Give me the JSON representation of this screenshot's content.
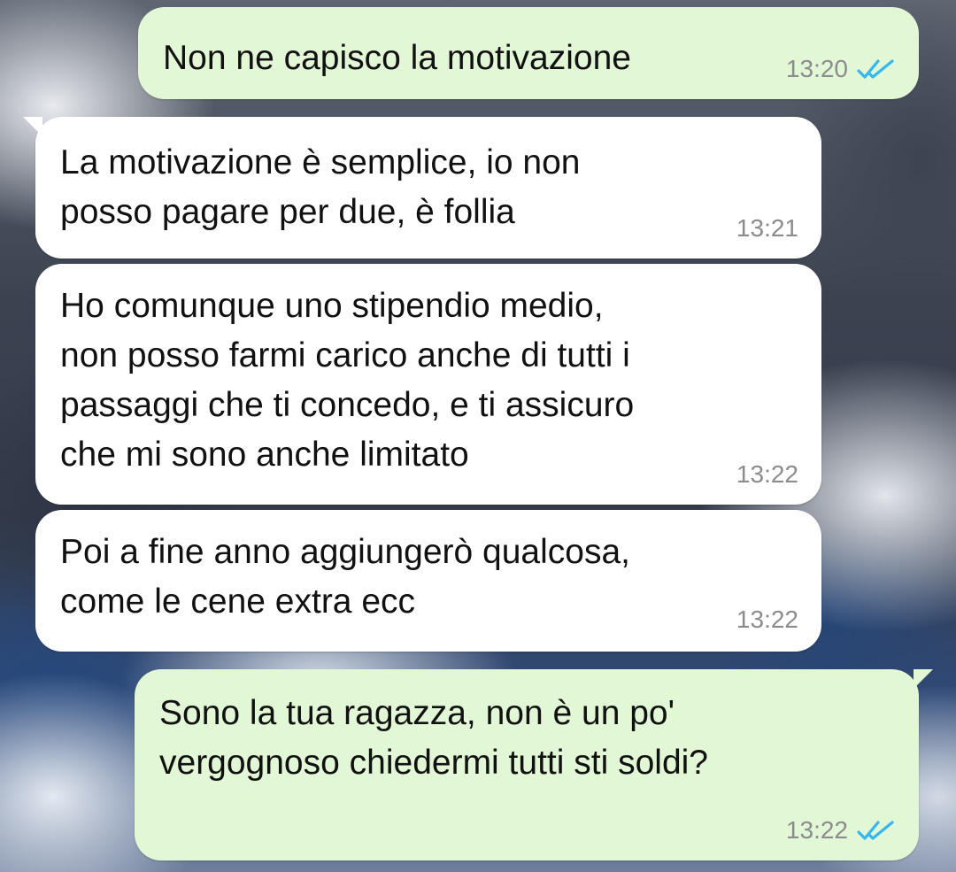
{
  "messages": [
    {
      "direction": "sent",
      "text": "Non ne capisco la motivazione",
      "time": "13:20",
      "status": "double-check-read-icon"
    },
    {
      "direction": "received",
      "text": "La motivazione è semplice, io non\nposso pagare per due, è follia",
      "time": "13:21"
    },
    {
      "direction": "received",
      "text": "Ho comunque uno stipendio medio,\nnon posso farmi carico anche di tutti i\npassaggi che ti concedo, e ti assicuro\nche mi sono anche limitato",
      "time": "13:22"
    },
    {
      "direction": "received",
      "text": "Poi a fine anno aggiungerò qualcosa,\ncome le cene extra ecc",
      "time": "13:22"
    },
    {
      "direction": "sent",
      "text": "Sono la tua ragazza, non è un po'\nvergognoso chiedermi tutti sti soldi?",
      "time": "13:22",
      "status": "double-check-read-icon"
    }
  ],
  "colors": {
    "sent_bubble": "#e1f7d5",
    "received_bubble": "#ffffff",
    "read_check": "#34b7f1",
    "timestamp": "#8c8c8c"
  }
}
